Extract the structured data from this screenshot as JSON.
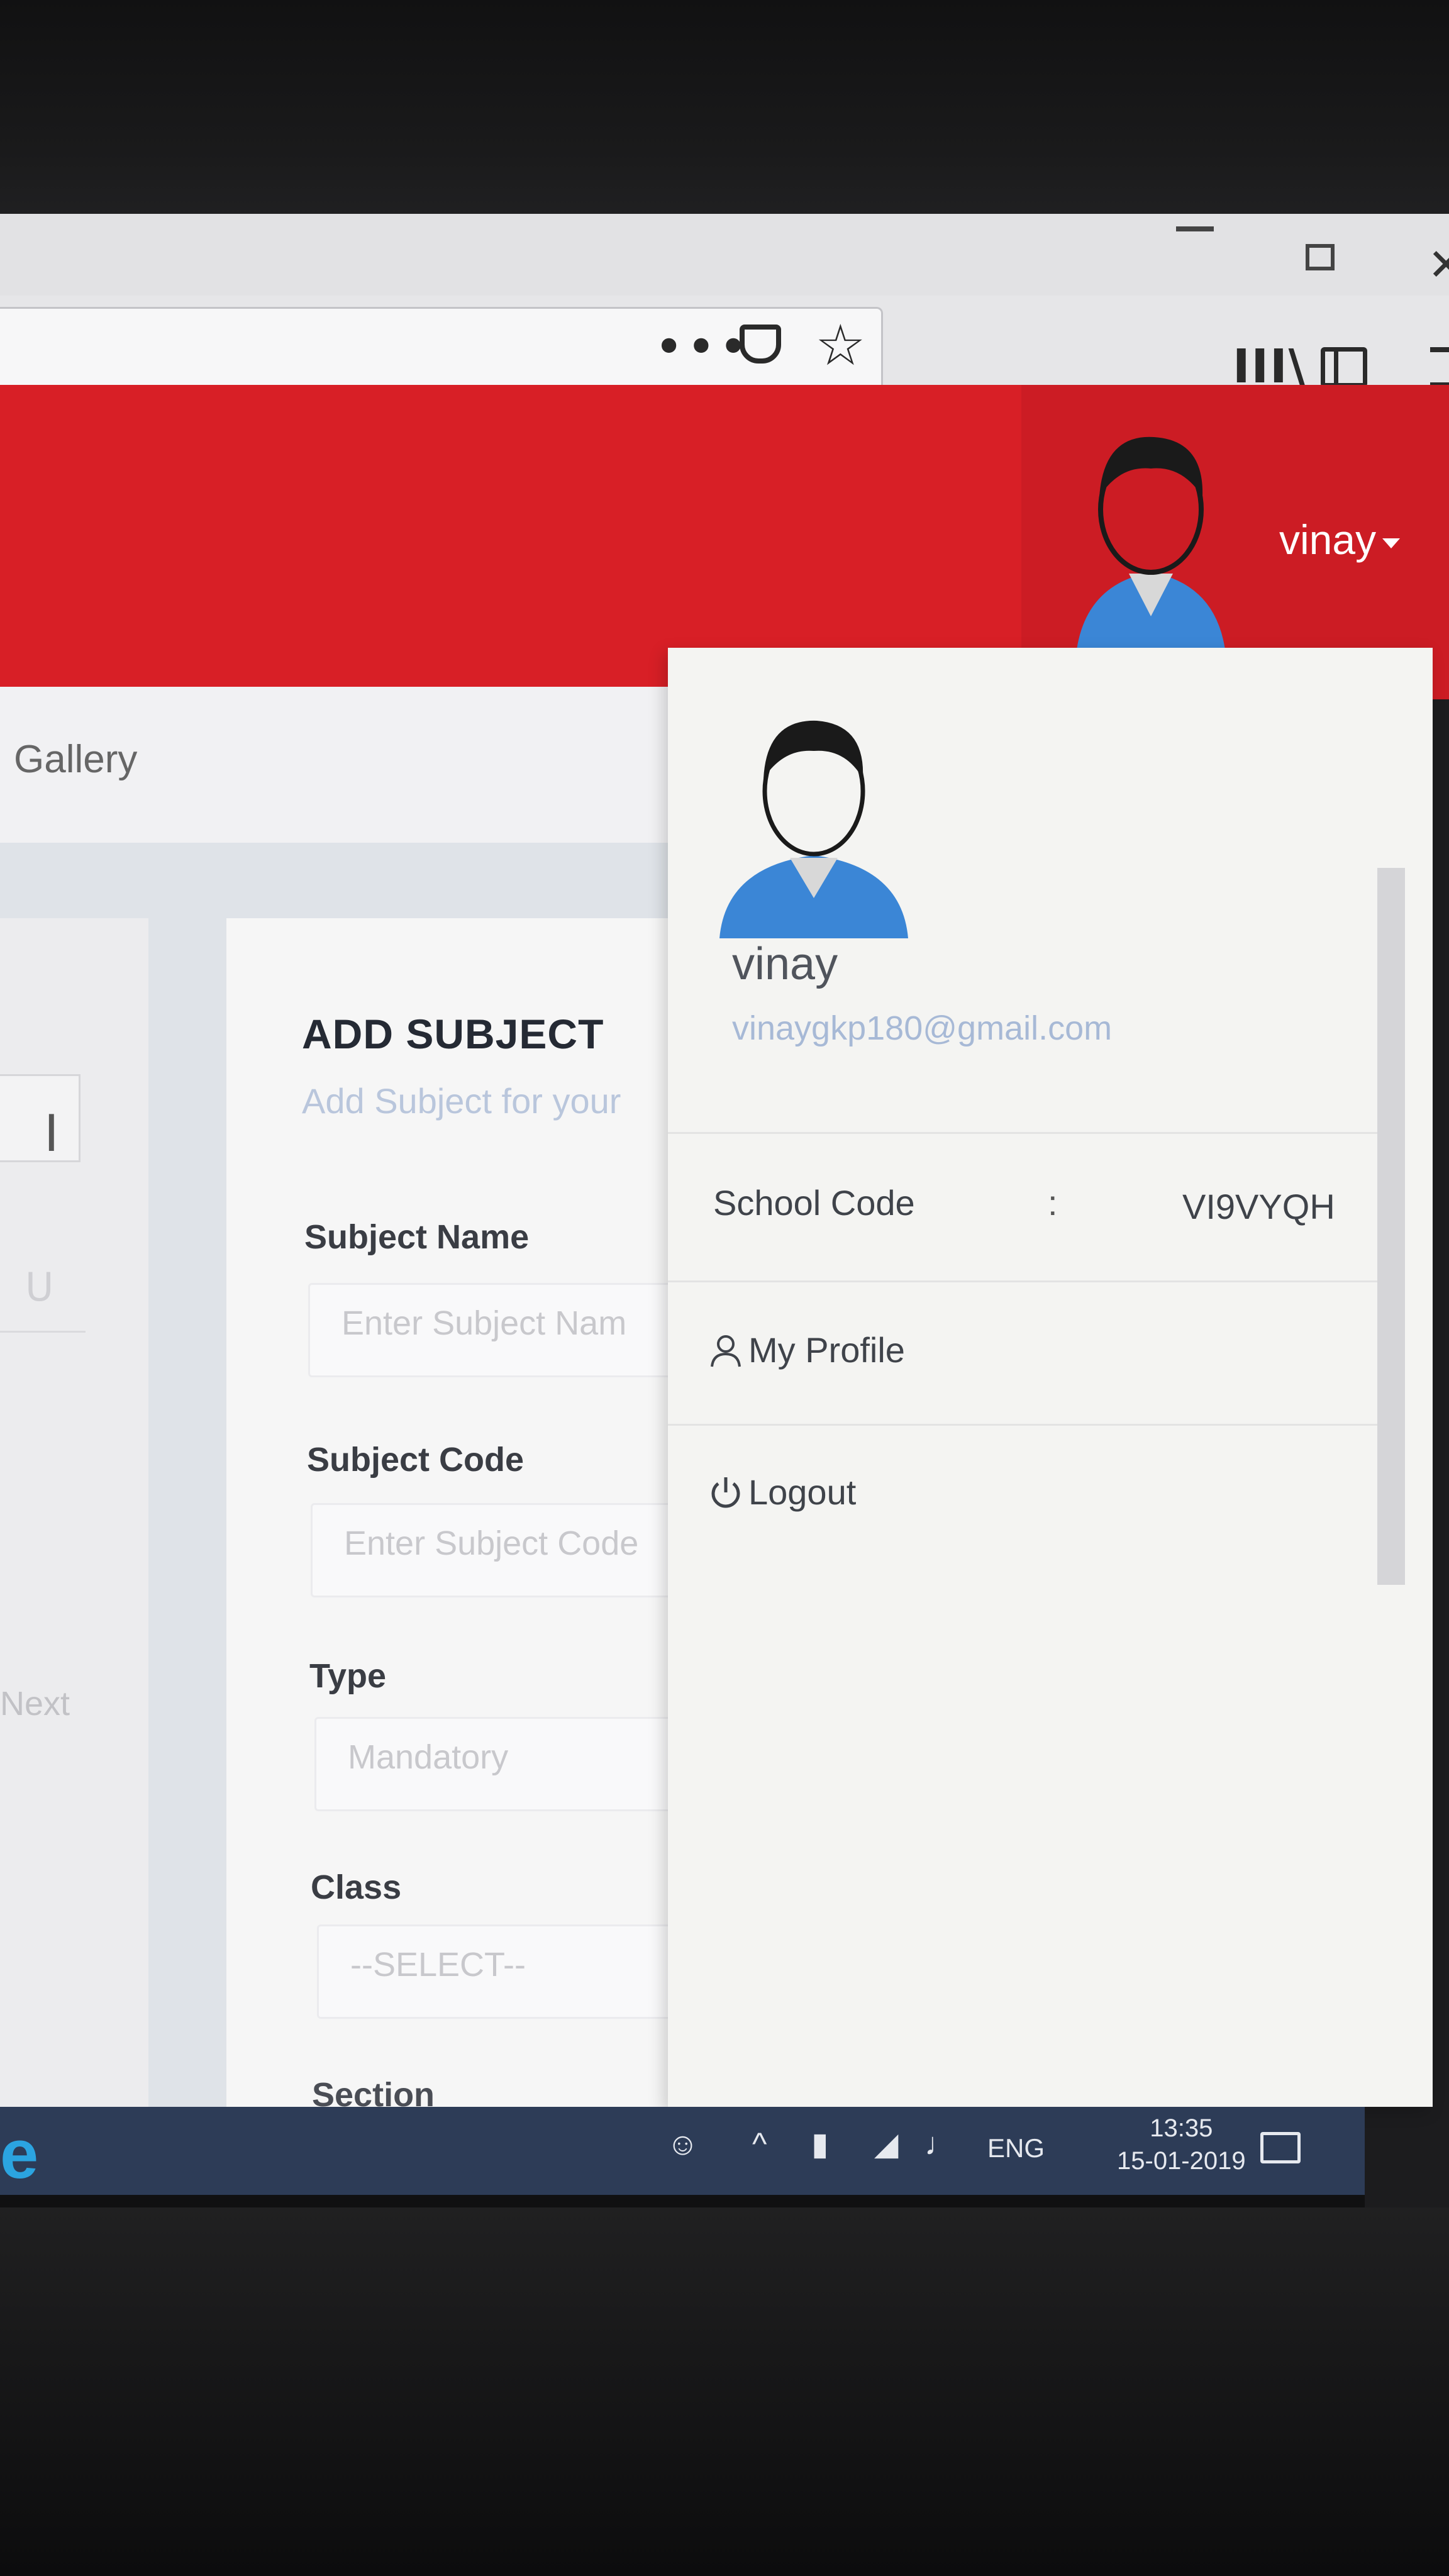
{
  "browser": {
    "toolbar_icons": [
      "more-icon",
      "pocket-icon",
      "star-icon",
      "library-icon",
      "sidebar-icon",
      "menu-icon"
    ],
    "dots": "•••",
    "star": "☆",
    "library": "III\\",
    "close": "✕"
  },
  "header": {
    "username": "vinay",
    "colors": {
      "header_bg": "#d81f26",
      "avatar_shirt": "#3b86d6"
    }
  },
  "nav": {
    "gallery_label": "Gallery"
  },
  "left_panel": {
    "next_label": "Next",
    "faded_value": "U"
  },
  "form": {
    "title": "ADD SUBJECT",
    "subtitle": "Add Subject for your",
    "subject_name_label": "Subject Name",
    "subject_name_placeholder": "Enter Subject Nam",
    "subject_code_label": "Subject Code",
    "subject_code_placeholder": "Enter Subject Code",
    "type_label": "Type",
    "type_value": "Mandatory",
    "class_label": "Class",
    "class_value": "--SELECT--",
    "section_label": "Section"
  },
  "dropdown": {
    "name": "vinay",
    "email": "vinaygkp180@gmail.com",
    "school_code_label": "School Code",
    "colon": ":",
    "school_code_value": "VI9VYQH",
    "my_profile_label": "My Profile",
    "logout_label": "Logout"
  },
  "taskbar": {
    "language": "ENG",
    "time": "13:35",
    "date": "15-01-2019",
    "edge_glyph": "e",
    "caret": "^"
  }
}
